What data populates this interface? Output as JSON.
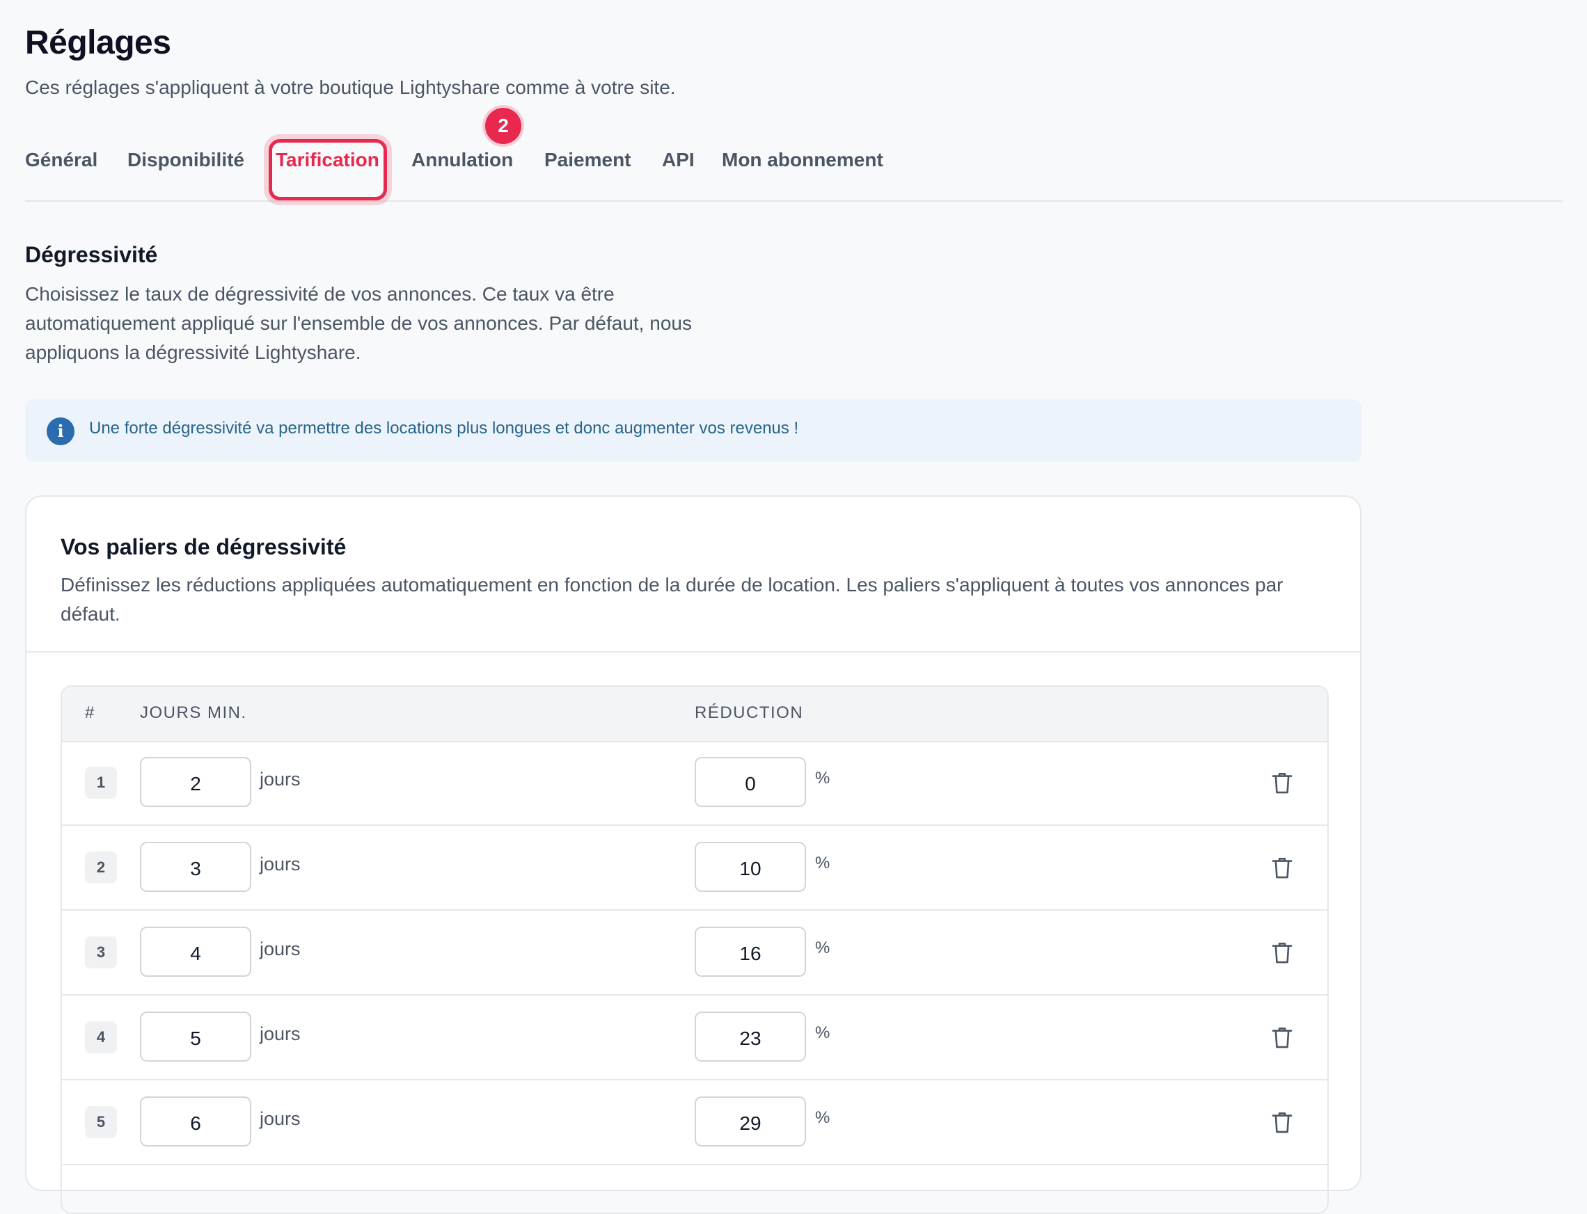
{
  "page": {
    "title": "Réglages",
    "subtitle": "Ces réglages s'appliquent à votre boutique Lightyshare comme à votre site."
  },
  "tabs": [
    {
      "label": "Général"
    },
    {
      "label": "Disponibilité"
    },
    {
      "label": "Tarification",
      "active": true
    },
    {
      "label": "Annulation"
    },
    {
      "label": "Paiement"
    },
    {
      "label": "API"
    },
    {
      "label": "Mon abonnement"
    }
  ],
  "annotation": {
    "step_badge": "2"
  },
  "section": {
    "title": "Dégressivité",
    "description": "Choisissez le taux de dégressivité de vos annonces. Ce taux va être automatiquement appliqué sur l'ensemble de vos annonces. Par défaut, nous appliquons la dégressivité Lightyshare."
  },
  "info": {
    "icon": "info-icon",
    "icon_glyph": "i",
    "text": "Une forte dégressivité va permettre des locations plus longues et donc augmenter vos revenus !"
  },
  "tiers_card": {
    "title": "Vos paliers de dégressivité",
    "description": "Définissez les réductions appliquées automatiquement en fonction de la durée de location. Les paliers s'appliquent à toutes vos annonces par défaut.",
    "columns": {
      "num": "#",
      "min_days": "JOURS MIN.",
      "reduction": "RÉDUCTION"
    },
    "unit_days": "jours",
    "unit_pct": "%",
    "rows": [
      {
        "num": "1",
        "days": "2",
        "reduction": "0"
      },
      {
        "num": "2",
        "days": "3",
        "reduction": "10"
      },
      {
        "num": "3",
        "days": "4",
        "reduction": "16"
      },
      {
        "num": "4",
        "days": "5",
        "reduction": "23"
      },
      {
        "num": "5",
        "days": "6",
        "reduction": "29"
      }
    ]
  },
  "colors": {
    "accent": "#e8284f",
    "info_bg": "#edf3fb",
    "info_text": "#27648a",
    "info_icon": "#2b6cb0"
  }
}
